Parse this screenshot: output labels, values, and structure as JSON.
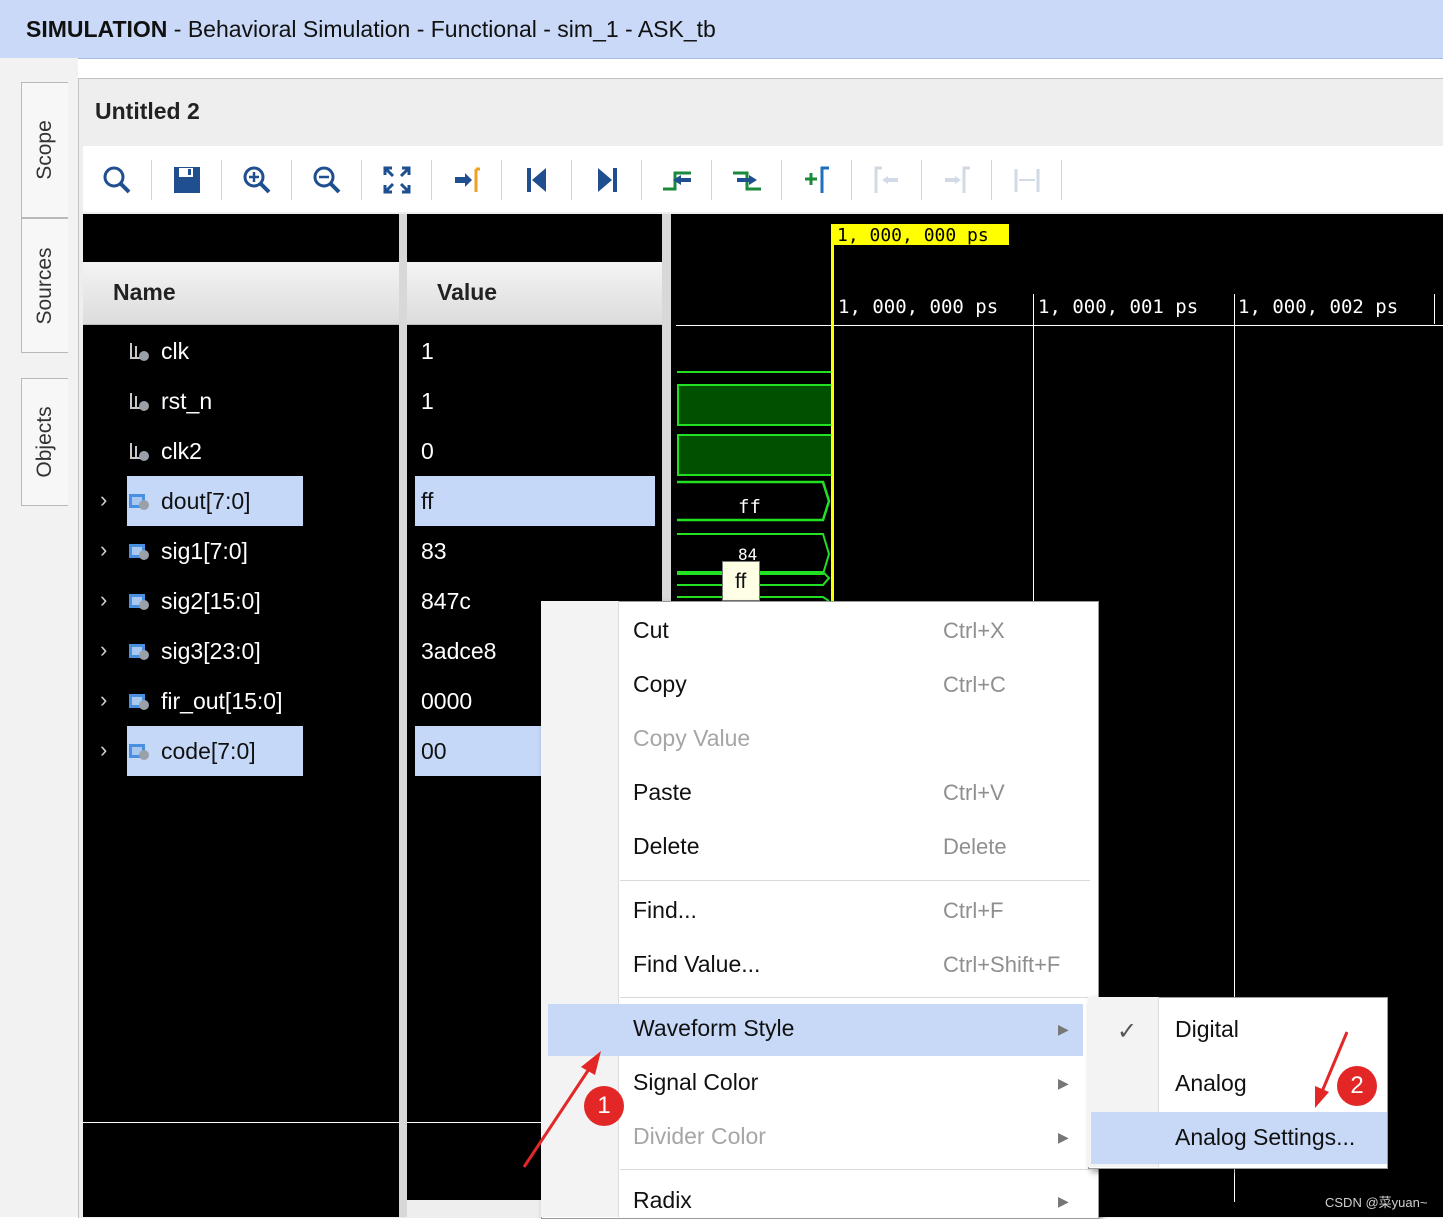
{
  "title_bar": {
    "mode": "SIMULATION",
    "rest": " - Behavioral Simulation - Functional - sim_1 - ASK_tb"
  },
  "side_tabs": [
    "Scope",
    "Sources",
    "Objects"
  ],
  "window": {
    "title": "Untitled 2"
  },
  "toolbar": {
    "icons": [
      "search-icon",
      "save-icon",
      "zoom-in-icon",
      "zoom-out-icon",
      "zoom-fit-icon",
      "goto-cursor-icon",
      "goto-start-icon",
      "goto-end-icon",
      "previous-transition-icon",
      "next-transition-icon",
      "add-marker-icon",
      "previous-marker-icon",
      "next-marker-icon",
      "swap-cursors-icon"
    ]
  },
  "columns": {
    "name": "Name",
    "value": "Value"
  },
  "signals": [
    {
      "name": "clk",
      "value": "1",
      "bus": false,
      "selected": false
    },
    {
      "name": "rst_n",
      "value": "1",
      "bus": false,
      "selected": false
    },
    {
      "name": "clk2",
      "value": "0",
      "bus": false,
      "selected": false
    },
    {
      "name": "dout[7:0]",
      "value": "ff",
      "bus": true,
      "selected": true
    },
    {
      "name": "sig1[7:0]",
      "value": "83",
      "bus": true,
      "selected": false
    },
    {
      "name": "sig2[15:0]",
      "value": "847c",
      "bus": true,
      "selected": false
    },
    {
      "name": "sig3[23:0]",
      "value": "3adce8",
      "bus": true,
      "selected": false
    },
    {
      "name": "fir_out[15:0]",
      "value": "0000",
      "bus": true,
      "selected": false
    },
    {
      "name": "code[7:0]",
      "value": "00",
      "bus": true,
      "selected": true
    }
  ],
  "wave": {
    "cursor_label": "1, 000, 000  ps",
    "ticks": [
      "1, 000, 000  ps",
      "1, 000, 001  ps",
      "1, 000, 002  ps"
    ],
    "bus_label_dout": "ff",
    "bus_label_sig1": "84",
    "tooltip": "ff",
    "colors": {
      "wave": "#22e022",
      "cursor": "#ffff00",
      "bus_fill": "#005000"
    }
  },
  "context_menu": {
    "items": [
      {
        "label": "Cut",
        "shortcut": "Ctrl+X",
        "disabled": false
      },
      {
        "label": "Copy",
        "shortcut": "Ctrl+C",
        "disabled": false
      },
      {
        "label": "Copy Value",
        "shortcut": "",
        "disabled": true
      },
      {
        "label": "Paste",
        "shortcut": "Ctrl+V",
        "disabled": false
      },
      {
        "label": "Delete",
        "shortcut": "Delete",
        "disabled": false
      },
      {
        "label": "Find...",
        "shortcut": "Ctrl+F",
        "disabled": false
      },
      {
        "label": "Find Value...",
        "shortcut": "Ctrl+Shift+F",
        "disabled": false
      },
      {
        "label": "Waveform Style",
        "shortcut": "",
        "disabled": false,
        "submenu": true,
        "highlighted": true
      },
      {
        "label": "Signal Color",
        "shortcut": "",
        "disabled": false,
        "submenu": true
      },
      {
        "label": "Divider Color",
        "shortcut": "",
        "disabled": true,
        "submenu": true
      },
      {
        "label": "Radix",
        "shortcut": "",
        "disabled": false,
        "submenu": true
      }
    ]
  },
  "submenu": {
    "items": [
      {
        "label": "Digital",
        "checked": true
      },
      {
        "label": "Analog",
        "checked": false
      },
      {
        "label": "Analog Settings...",
        "checked": false,
        "highlighted": true
      }
    ]
  },
  "annotations": {
    "badge1": "1",
    "badge2": "2",
    "color": "#e32626"
  },
  "watermark": "CSDN @菜yuan~"
}
